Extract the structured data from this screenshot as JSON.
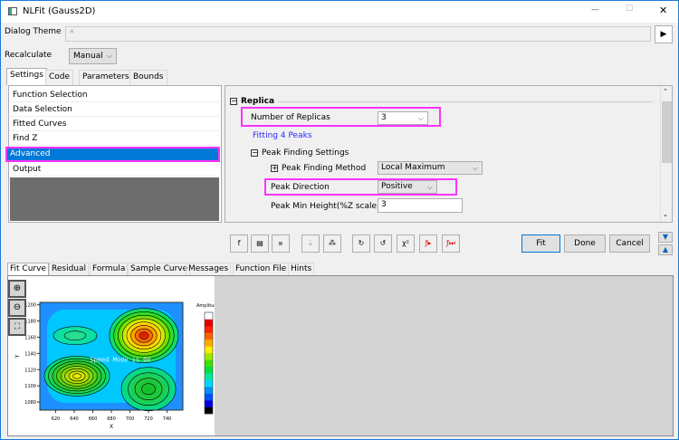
{
  "window": {
    "title": "NLFit (Gauss2D)",
    "minimize": "—",
    "maximize": "☐",
    "close": "✕"
  },
  "theme": {
    "label": "Dialog Theme",
    "value": "*",
    "arrow": "▶"
  },
  "recalc": {
    "label": "Recalculate",
    "value": "Manual"
  },
  "tabs": [
    {
      "label": "Settings",
      "selected": true
    },
    {
      "label": "Code"
    },
    {
      "label": "Parameters"
    },
    {
      "label": "Bounds"
    }
  ],
  "nav": {
    "items": [
      {
        "label": "Function Selection"
      },
      {
        "label": "Data Selection"
      },
      {
        "label": "Fitted Curves"
      },
      {
        "label": "Find Z"
      },
      {
        "label": "Advanced",
        "selected": true
      },
      {
        "label": "Output"
      }
    ]
  },
  "settings": {
    "section": "Replica",
    "replicas_label": "Number of Replicas",
    "replicas_value": "3",
    "fitting_note": "Fitting 4 Peaks",
    "peak_settings": "Peak Finding Settings",
    "method_label": "Peak Finding Method",
    "method_value": "Local Maximum",
    "direction_label": "Peak Direction",
    "direction_value": "Positive",
    "min_height_label": "Peak Min Height(%Z scale)",
    "min_height_value": "3"
  },
  "toolbar": {
    "icons": [
      "function-editor-icon",
      "function-file-icon",
      "save-icon",
      "parameter-init-icon",
      "find-peaks-icon",
      "one-iteration-icon",
      "fit-until-converged-icon",
      "chi-square-icon",
      "fit-step-icon",
      "fit-until-end-icon"
    ],
    "fit": "Fit",
    "done": "Done",
    "cancel": "Cancel"
  },
  "bottom_tabs": [
    {
      "label": "Fit Curve",
      "selected": true
    },
    {
      "label": "Residual"
    },
    {
      "label": "Formula"
    },
    {
      "label": "Sample Curve"
    },
    {
      "label": "Messages"
    },
    {
      "label": "Function File"
    },
    {
      "label": "Hints"
    }
  ],
  "chart_data": {
    "type": "heatmap",
    "subtype": "contour",
    "xlabel": "X",
    "ylabel": "Y",
    "xlim": [
      603,
      757
    ],
    "ylim": [
      1070,
      1203
    ],
    "xticks": [
      620,
      640,
      660,
      680,
      700,
      720,
      740
    ],
    "yticks": [
      1080,
      1100,
      1120,
      1140,
      1160,
      1180,
      1200
    ],
    "colorbar_title": "Amplitude",
    "overlay_text": "Speed Mode is On",
    "peaks": [
      {
        "x": 715,
        "y": 1162,
        "amplitude": "high"
      },
      {
        "x": 643,
        "y": 1112,
        "amplitude": "medium-high"
      },
      {
        "x": 720,
        "y": 1096,
        "amplitude": "medium"
      },
      {
        "x": 641,
        "y": 1162,
        "amplitude": "low"
      }
    ]
  }
}
